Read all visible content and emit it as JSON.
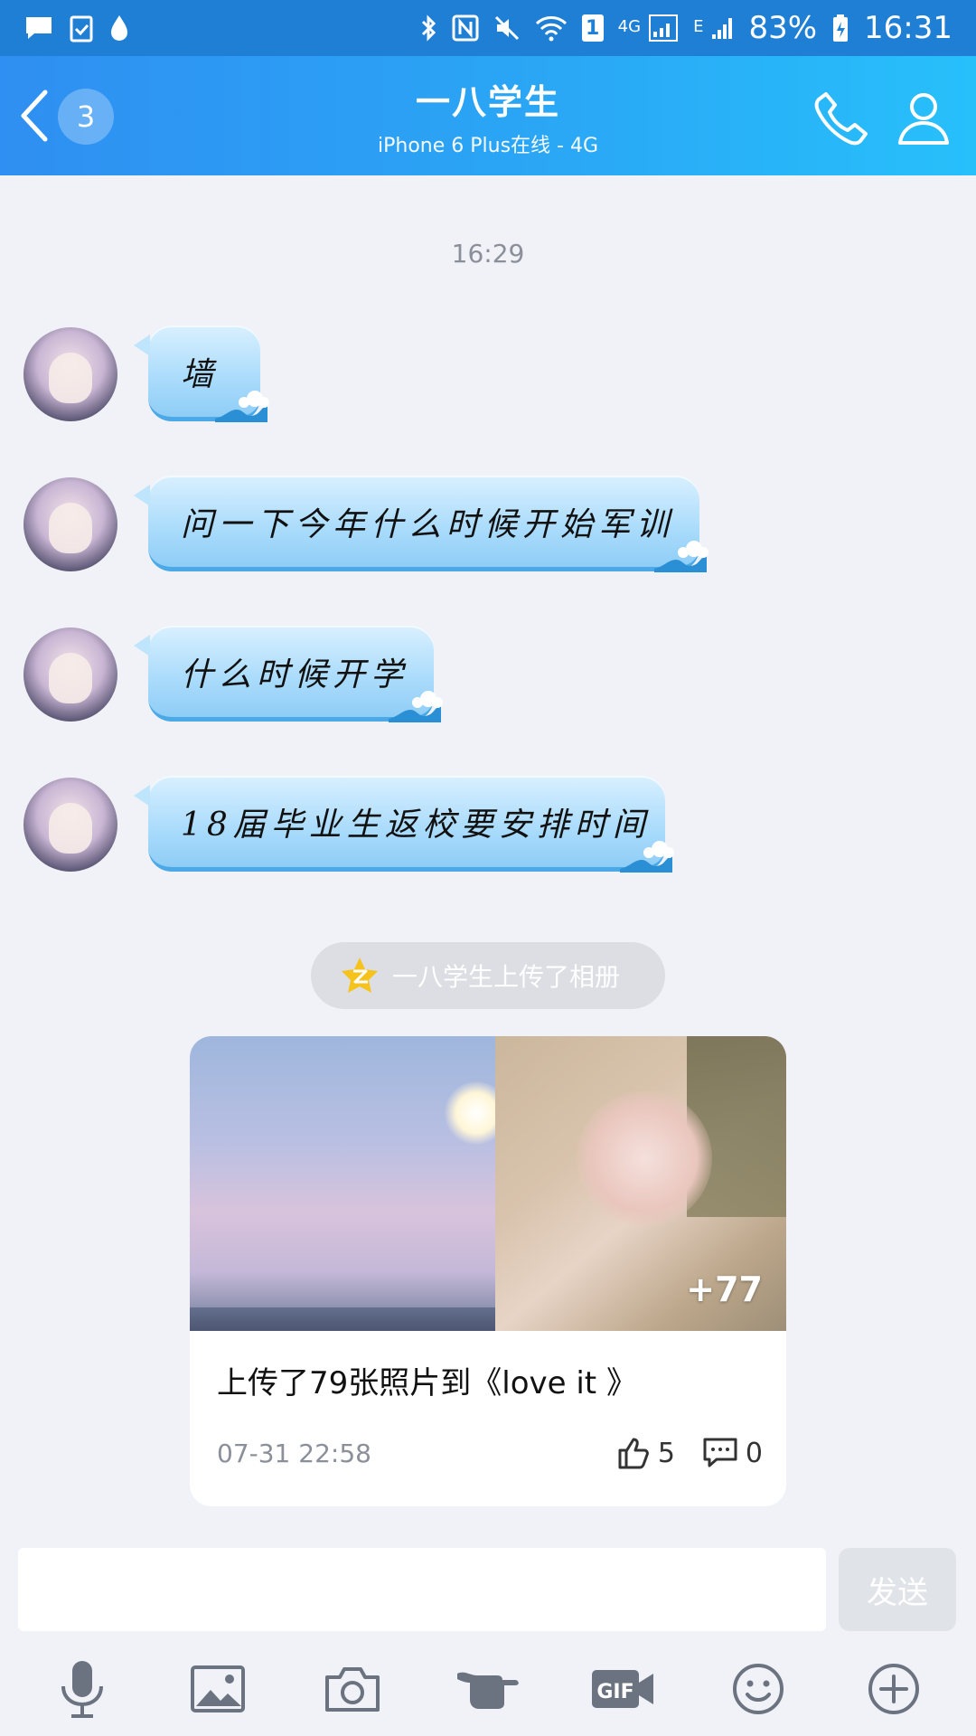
{
  "status_bar": {
    "battery": "83%",
    "time": "16:31",
    "network_label_1": "4G",
    "network_label_2": "E",
    "sim_badge": "1",
    "icons": [
      "message-icon",
      "task-icon",
      "drop-icon",
      "bluetooth-icon",
      "nfc-icon",
      "mute-icon",
      "wifi-icon",
      "signal-icon",
      "battery-icon"
    ]
  },
  "header": {
    "back_badge": "3",
    "title": "一八学生",
    "subtitle": "iPhone 6 Plus在线 - 4G",
    "icons": [
      "back-chevron-icon",
      "phone-icon",
      "profile-icon"
    ]
  },
  "chat": {
    "timestamp": "16:29",
    "messages": [
      {
        "text": "墙"
      },
      {
        "text": "问一下今年什么时候开始军训"
      },
      {
        "text": "什么时候开学"
      },
      {
        "text": "18届毕业生返校要安排时间"
      }
    ],
    "system_notice": "一八学生上传了相册",
    "system_icon": "qzone-star-icon"
  },
  "album_card": {
    "more_count": "+77",
    "title": "上传了79张照片到《love it 》",
    "date": "07-31 22:58",
    "likes": "5",
    "comments": "0"
  },
  "input": {
    "placeholder": "",
    "value": "",
    "send_label": "发送"
  },
  "toolbar": {
    "icons": [
      "microphone-icon",
      "image-icon",
      "camera-icon",
      "poke-hand-icon",
      "gif-icon",
      "emoji-icon",
      "plus-icon"
    ]
  },
  "colors": {
    "header_start": "#2f8ff2",
    "header_end": "#27c0fb",
    "background": "#f0f2f7",
    "bubble": "#a9dbfb"
  }
}
